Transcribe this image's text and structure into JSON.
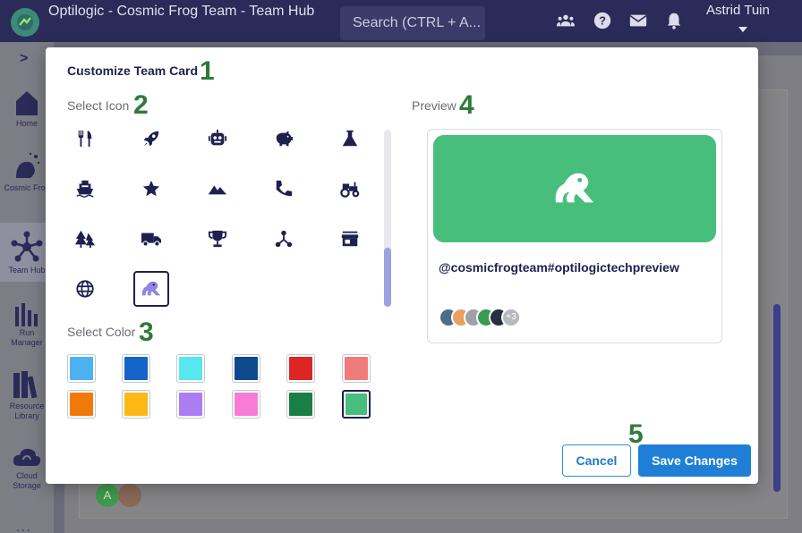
{
  "topbar": {
    "app_title": "Optilogic - Cosmic Frog Team - Team Hub",
    "search_placeholder": "Search (CTRL + A...",
    "user_name": "Astrid Tuin"
  },
  "sidebar": {
    "items": [
      {
        "label": "Home",
        "icon": "home-icon"
      },
      {
        "label": "Cosmic Frog",
        "icon": "cosmic-frog-icon"
      },
      {
        "label": "Team Hub",
        "icon": "team-hub-icon"
      },
      {
        "label": "Run Manager",
        "icon": "run-manager-icon"
      },
      {
        "label": "Resource Library",
        "icon": "resource-library-icon"
      },
      {
        "label": "Cloud Storage",
        "icon": "cloud-storage-icon"
      }
    ],
    "more": "..."
  },
  "modal": {
    "title": "Customize Team Card",
    "select_icon_label": "Select Icon",
    "select_color_label": "Select Color",
    "preview_label": "Preview",
    "step_numbers": [
      "1",
      "2",
      "3",
      "4",
      "5"
    ],
    "icons": [
      "utensils-icon",
      "rocket-icon",
      "robot-icon",
      "piggy-bank-icon",
      "flask-icon",
      "ship-icon",
      "star-icon",
      "mountain-icon",
      "phone-icon",
      "tractor-icon",
      "trees-icon",
      "truck-icon",
      "trophy-icon",
      "network-icon",
      "store-icon",
      "globe-icon",
      "frog-icon"
    ],
    "selected_icon": "frog-icon",
    "colors": [
      "#4db3f0",
      "#1565c8",
      "#55e8ee",
      "#0d4a8c",
      "#dc2626",
      "#f07b7b",
      "#f07a08",
      "#fbb817",
      "#ab7cf2",
      "#f77cd8",
      "#1a7f45",
      "#48be7c"
    ],
    "selected_color": "#48be7c",
    "preview": {
      "team_name": "@cosmicfrogteam#optilogictechpreview",
      "banner_color": "#48be7c",
      "avatar_overflow": "+3"
    },
    "cancel_label": "Cancel",
    "save_label": "Save Changes"
  },
  "background": {
    "avatar_initial": "A"
  }
}
